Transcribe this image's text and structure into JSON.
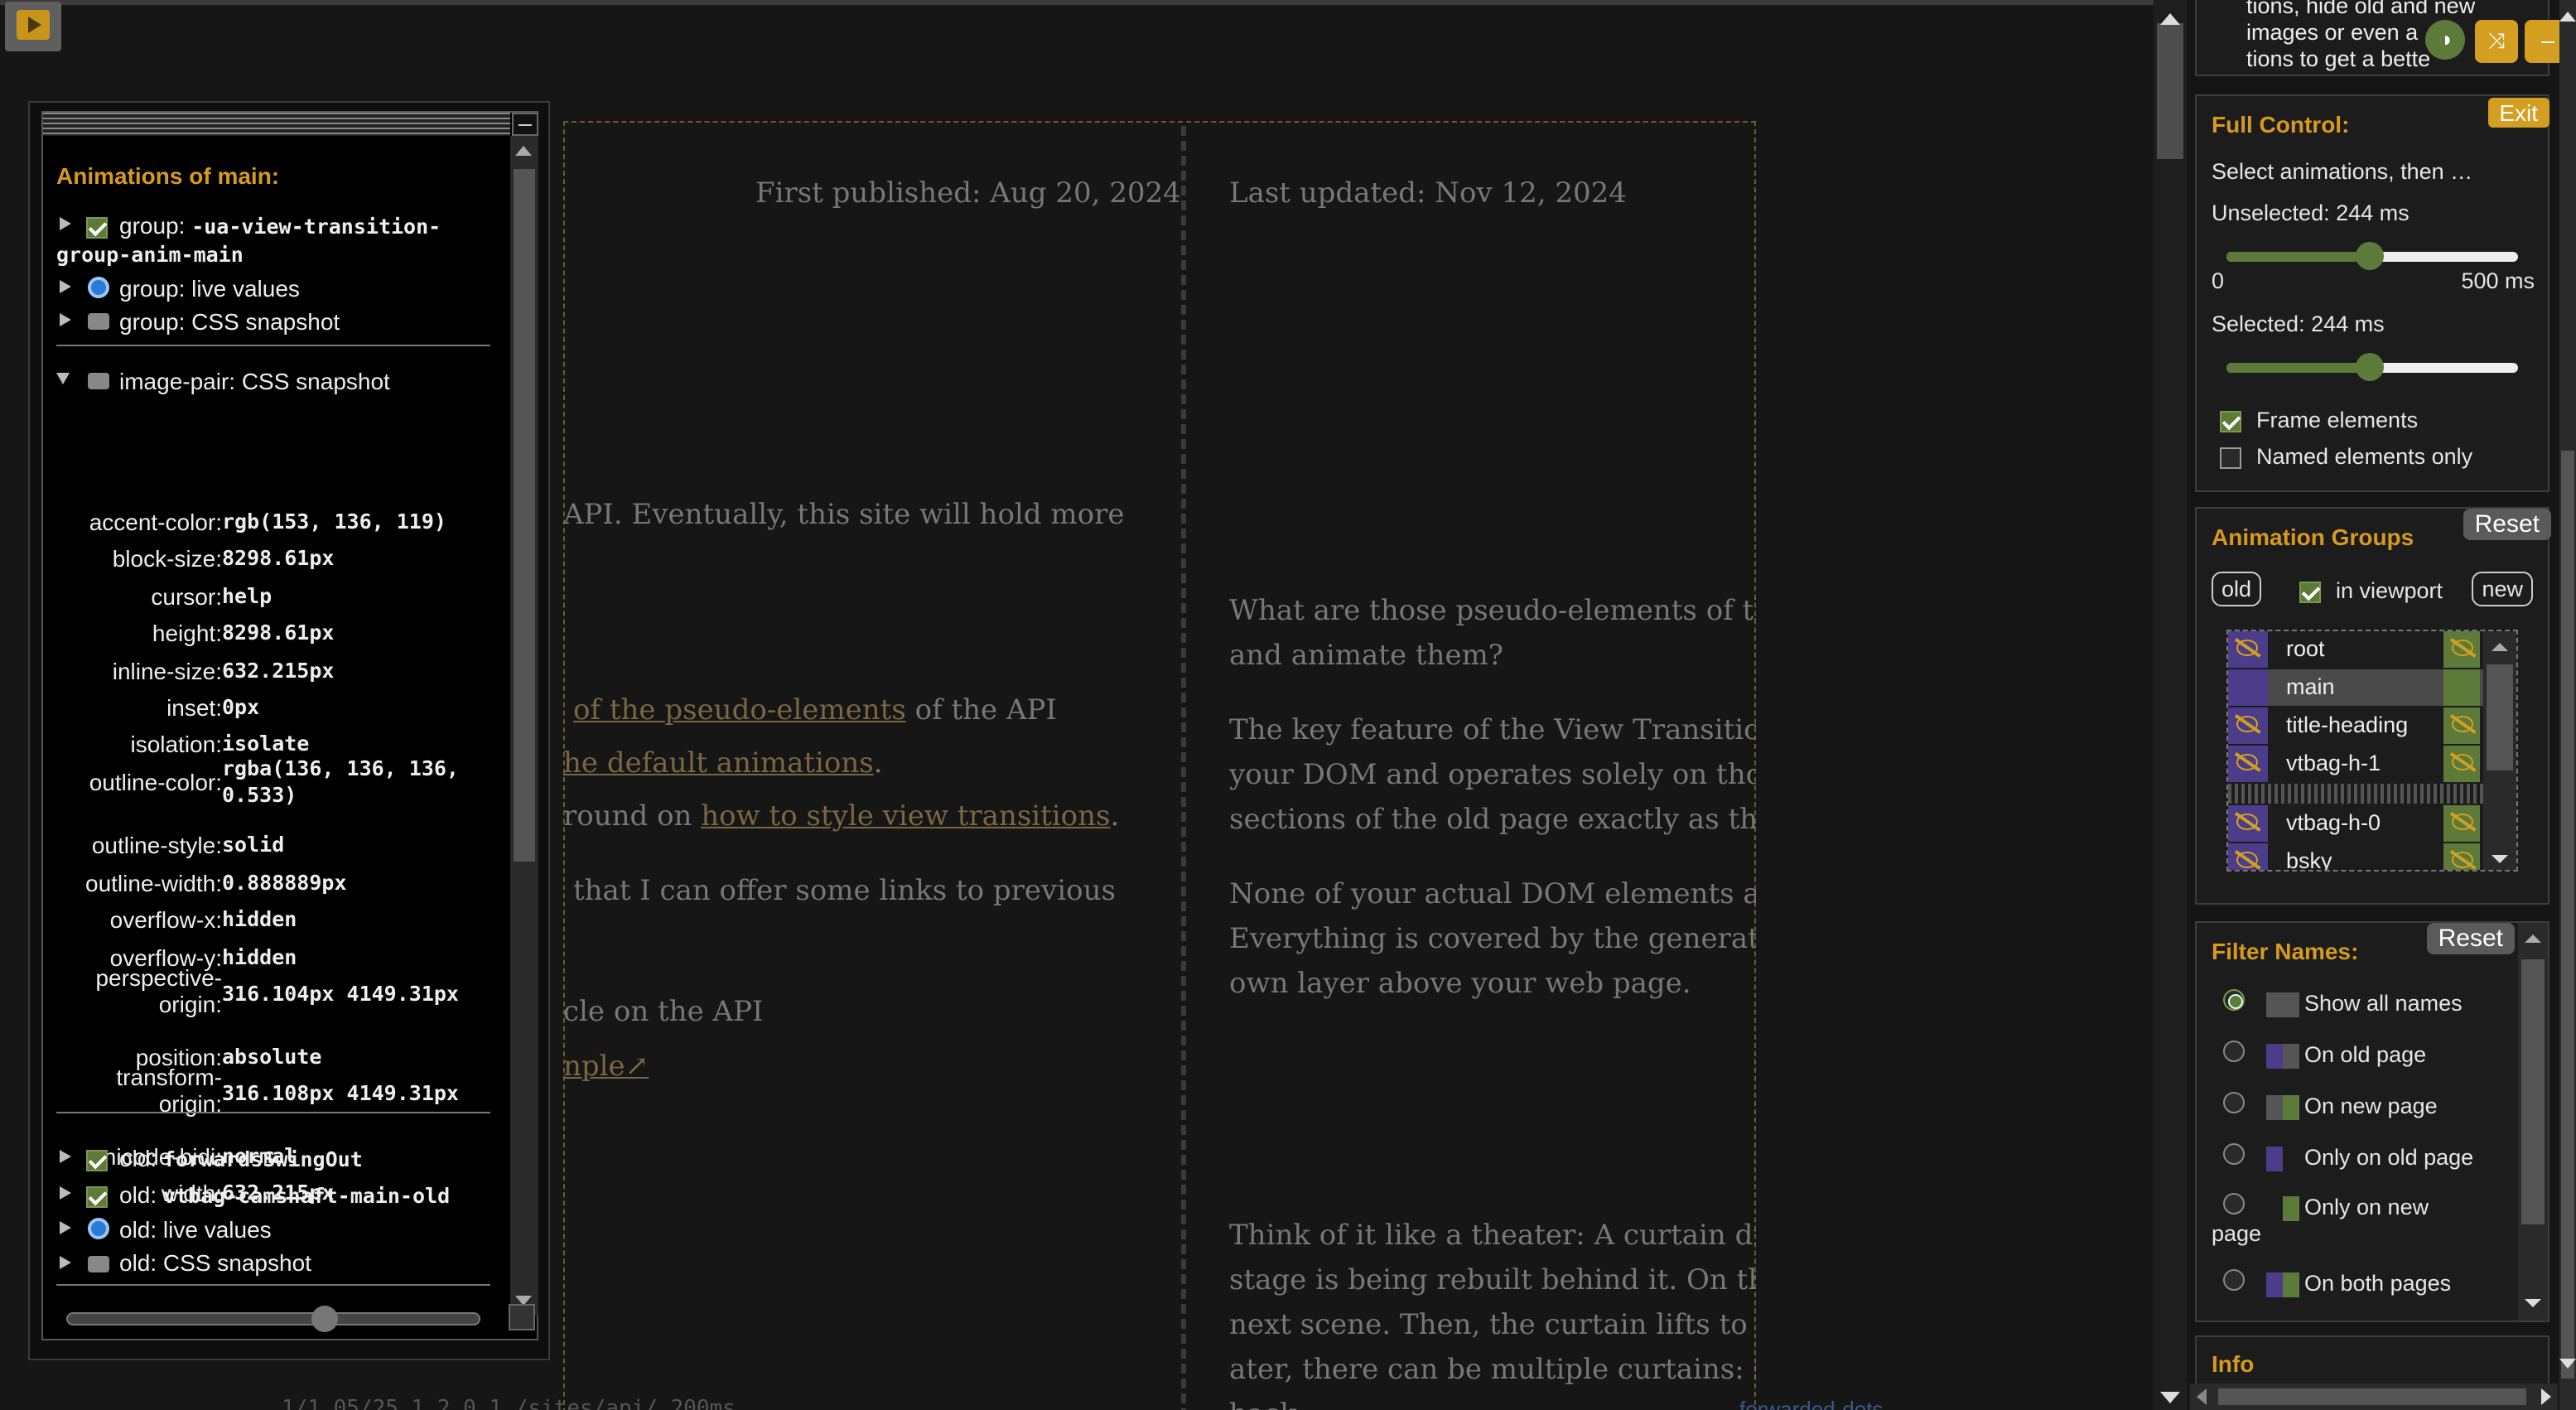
{
  "page": {
    "date_published": "First published: Aug 20, 2024",
    "date_updated": "Last updated: Nov 12, 2024",
    "left_col": {
      "p1": "API. Eventually, this site will hold more",
      "p2_link": "of the pseudo-elements",
      "p2_rest": " of the API",
      "p3_link": "he default animations",
      "p3_rest": ".",
      "p4_pre": "round on ",
      "p4_link": "how to style view transitions",
      "p4_rest": ".",
      "p5": "that I can offer some links to previous",
      "p6": "cle on the API",
      "p7_link": "nple↗"
    },
    "right_col": {
      "p1a": "What are those pseudo-elements of the",
      "p1b": "and animate them?",
      "p2a": "The key feature of the View Transition A",
      "p2b": "your DOM and operates solely on those",
      "p2c": "sections of the old page exactly as they",
      "p3a": "None of your actual DOM elements are",
      "p3b": "Everything is covered by the generated",
      "p3c": "own layer above your web page.",
      "p4a": "Think of it like a theater: A curtain drops",
      "p4b": "stage is being rebuilt behind it. On the c",
      "p4c": "next scene. Then, the curtain lifts to reve",
      "p4d": "ater, there can be multiple curtains: som",
      "p4e": "back"
    },
    "footer_partial": "1/1.05/25  1.2.0.1  /sites/api/  200ms",
    "footer_link": "forwarded-dots"
  },
  "left_panel": {
    "title": "Animations of main:",
    "groups": [
      {
        "label": "group: -ua-view-transition-",
        "label2": "group-anim-main",
        "icon": "checkbox-checked"
      },
      {
        "label": "group: live values",
        "icon": "live-dot-icon"
      },
      {
        "label": "group: CSS snapshot",
        "icon": "camera-icon"
      }
    ],
    "image_pair_label": "image-pair: CSS snapshot",
    "props": [
      {
        "k": "accent-color:",
        "v": "rgb(153, 136, 119)"
      },
      {
        "k": "block-size:",
        "v": "8298.61px"
      },
      {
        "k": "cursor:",
        "v": "help"
      },
      {
        "k": "height:",
        "v": "8298.61px"
      },
      {
        "k": "inline-size:",
        "v": "632.215px"
      },
      {
        "k": "inset:",
        "v": "0px"
      },
      {
        "k": "isolation:",
        "v": "isolate"
      },
      {
        "k": "outline-color:",
        "v": "rgba(136, 136, 136,",
        "v2": "0.533)"
      },
      {
        "k": "outline-style:",
        "v": "solid"
      },
      {
        "k": "outline-width:",
        "v": "0.888889px"
      },
      {
        "k": "overflow-x:",
        "v": "hidden"
      },
      {
        "k": "overflow-y:",
        "v": "hidden"
      },
      {
        "k": "perspective-",
        "k2": "origin:",
        "v": "316.104px 4149.31px"
      },
      {
        "k": "position:",
        "v": "absolute"
      },
      {
        "k": "transform-",
        "k2": "origin:",
        "v": "316.108px 4149.31px"
      },
      {
        "k": "unicode-bidi:",
        "v": "normal"
      },
      {
        "k": "width:",
        "v": "632.215px"
      }
    ],
    "old_items": [
      {
        "label": "old: ",
        "mono": "forwardsSwingOut",
        "icon": "checkbox-checked"
      },
      {
        "label": "old: ",
        "mono": "vtbag-camshaft-main-old",
        "icon": "checkbox-checked"
      },
      {
        "label": "old: live values",
        "icon": "live-dot-icon"
      },
      {
        "label": "old: CSS snapshot",
        "icon": "camera-icon"
      }
    ],
    "zoom_fraction": 0.62
  },
  "right_panel": {
    "top_text": [
      "tions, hide old and new",
      "images or even a",
      "tions to get a bette"
    ],
    "full_control": {
      "title": "Full Control:",
      "exit": "Exit",
      "desc": "Select animations, then …",
      "unselected": "Unselected: 244 ms",
      "min": "0",
      "max": "500 ms",
      "selected": "Selected: 244 ms",
      "slider_unselected": 0.488,
      "slider_selected": 0.488,
      "frame_elements": "Frame elements",
      "named_only": "Named elements only"
    },
    "animation_groups": {
      "title": "Animation Groups",
      "reset": "Reset",
      "old": "old",
      "in_viewport": "in viewport",
      "new": "new",
      "items": [
        "root",
        "main",
        "title-heading",
        "vtbag-h-1",
        "",
        "vtbag-h-0",
        "bsky"
      ],
      "selected_item": "main"
    },
    "filter_names": {
      "title": "Filter Names:",
      "reset": "Reset",
      "options": [
        "Show all names",
        "On old page",
        "On new page",
        "Only on old page",
        "Only on new",
        "page",
        "On both pages"
      ],
      "selected": "Show all names"
    },
    "info_title": "Info"
  },
  "colors": {
    "accent": "#d49f20",
    "old": "#4b3d8a",
    "new": "#5c7a3a",
    "title": "#d69a1e"
  }
}
